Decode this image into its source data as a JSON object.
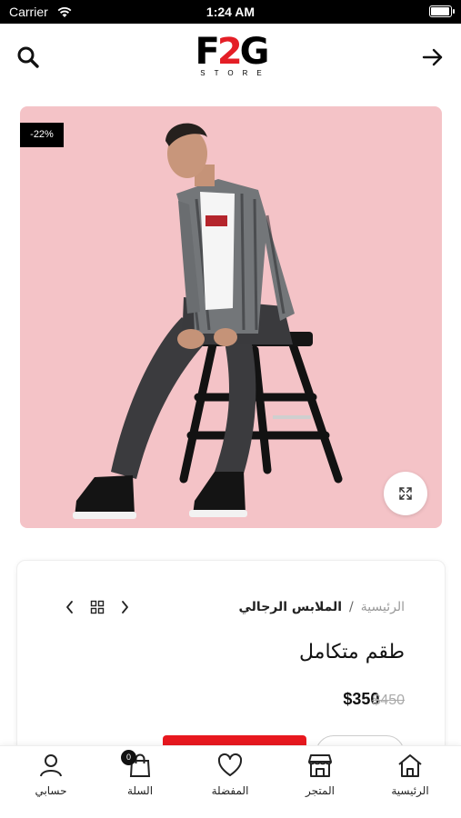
{
  "status_bar": {
    "carrier": "Carrier",
    "time": "1:24 AM",
    "battery_level": 1.0
  },
  "header": {
    "logo": {
      "mark_left": "F",
      "mark_mid": "2",
      "mark_right": "G",
      "sub": "STORE"
    },
    "search_icon": "search-icon",
    "back_icon": "arrow-right-icon"
  },
  "product": {
    "discount_badge": "-22%",
    "zoom_icon": "expand-icon",
    "breadcrumb": {
      "home": "الرئيسية",
      "separator": "/",
      "category": "الملابس الرجالي"
    },
    "pager_icons": [
      "chevron-left-icon",
      "grid-icon",
      "chevron-right-icon"
    ],
    "title": "طقم متكامل",
    "price": {
      "current": "$350",
      "old": "$450"
    }
  },
  "tab_bar": {
    "items": [
      {
        "label": "حسابي",
        "icon": "user-icon"
      },
      {
        "label": "السلة",
        "icon": "shopping-bag-icon",
        "badge": "0"
      },
      {
        "label": "المفضلة",
        "icon": "heart-icon"
      },
      {
        "label": "المتجر",
        "icon": "store-icon"
      },
      {
        "label": "الرئيسية",
        "icon": "home-icon"
      }
    ]
  },
  "colors": {
    "accent": "#e8181f",
    "logo_red": "#e41e26",
    "image_background": "#f4c3c7",
    "badge_background": "#000000"
  }
}
